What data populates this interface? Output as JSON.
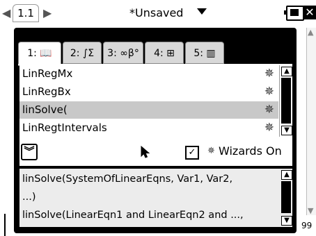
{
  "topbar": {
    "nav_left": "◀",
    "tab_label": "1.1",
    "nav_right": "▶",
    "doc_title": "*Unsaved"
  },
  "document": {
    "page_number_fragment": "99"
  },
  "catalog": {
    "tabs": [
      {
        "number": "1:",
        "icon": "📖"
      },
      {
        "number": "2:",
        "icon": "∫Σ"
      },
      {
        "number": "3:",
        "icon": "∞β°"
      },
      {
        "number": "4:",
        "icon": "⊞"
      },
      {
        "number": "5:",
        "icon": "▥"
      }
    ],
    "items": [
      {
        "label": "LinRegMx",
        "icon": "wizard-wand-icon"
      },
      {
        "label": "LinRegBx",
        "icon": "wizard-wand-icon"
      },
      {
        "label": "linSolve(",
        "icon": "wizard-wand-icon",
        "selected": true
      },
      {
        "label": "LinRegtIntervals",
        "icon": "wizard-wand-icon"
      }
    ],
    "wizards_label": "Wizards On",
    "wizards_checked": true,
    "help_lines": [
      "linSolve(SystemOfLinearEqns, Var1, Var2,",
      "...)",
      "linSolve(LinearEqn1 and LinearEqn2 and ...,"
    ]
  }
}
